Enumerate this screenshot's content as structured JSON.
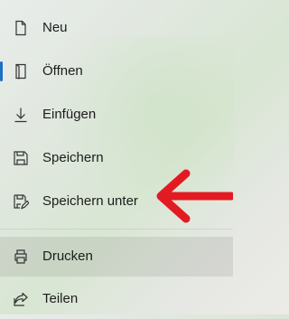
{
  "menu": {
    "items": [
      {
        "label": "Neu",
        "icon": "new-document-icon"
      },
      {
        "label": "Öffnen",
        "icon": "open-document-icon",
        "selected": true
      },
      {
        "label": "Einfügen",
        "icon": "insert-arrow-icon"
      },
      {
        "label": "Speichern",
        "icon": "save-icon"
      },
      {
        "label": "Speichern unter",
        "icon": "save-as-icon"
      },
      {
        "label": "Drucken",
        "icon": "print-icon",
        "highlighted": true
      },
      {
        "label": "Teilen",
        "icon": "share-icon"
      }
    ]
  },
  "annotation": {
    "arrow_color": "#e21b23",
    "points_to": "Speichern unter"
  },
  "colors": {
    "accent": "#1b6fc4",
    "text": "#1c1c1c"
  }
}
